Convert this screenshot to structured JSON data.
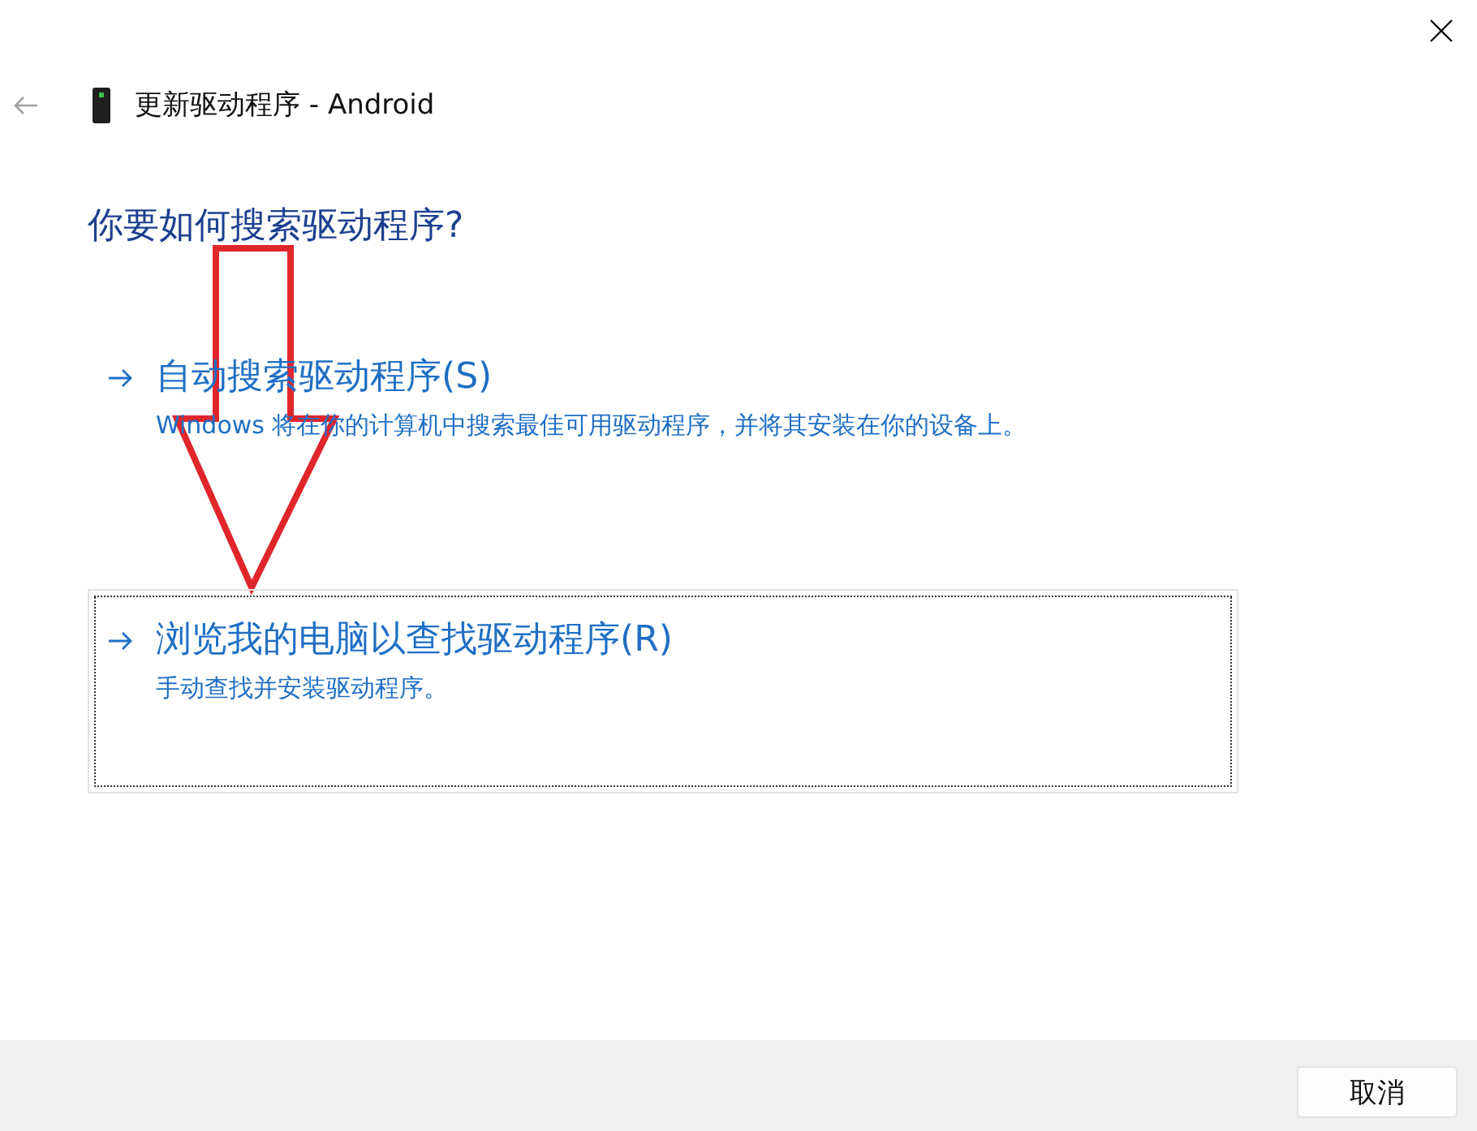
{
  "header": {
    "title": "更新驱动程序 - Android"
  },
  "heading": "你要如何搜索驱动程序?",
  "options": [
    {
      "label": "自动搜索驱动程序(S)",
      "description": "Windows 将在你的计算机中搜索最佳可用驱动程序，并将其安装在你的设备上。",
      "focused": false
    },
    {
      "label": "浏览我的电脑以查找驱动程序(R)",
      "description": "手动查找并安装驱动程序。",
      "focused": true
    }
  ],
  "footer": {
    "buttons": [
      "取消"
    ]
  }
}
